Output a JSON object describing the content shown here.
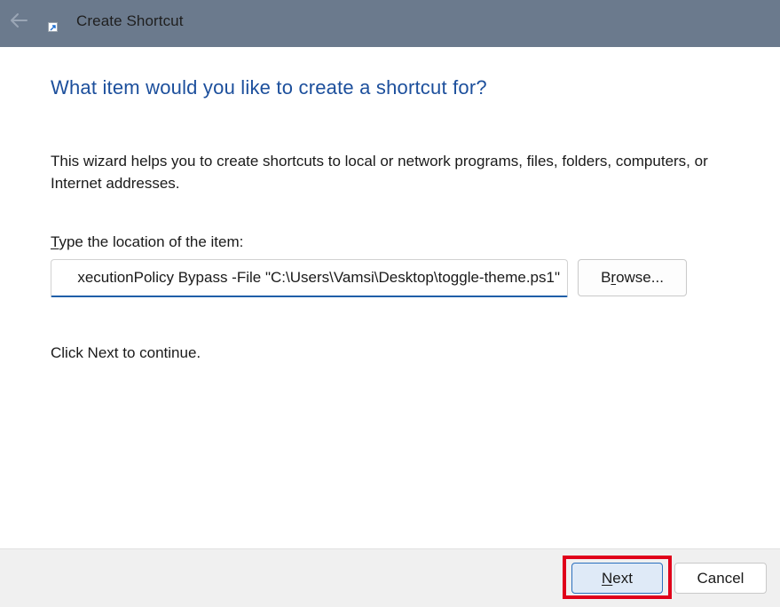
{
  "window": {
    "title": "Create Shortcut",
    "back_icon": "arrow-left-icon",
    "app_icon": "shortcut-icon"
  },
  "main": {
    "heading": "What item would you like to create a shortcut for?",
    "description": "This wizard helps you to create shortcuts to local or network programs, files, folders, computers, or Internet addresses.",
    "location": {
      "label_accel": "T",
      "label_rest": "ype the location of the item:",
      "value": "xecutionPolicy Bypass -File \"C:\\Users\\Vamsi\\Desktop\\toggle-theme.ps1\""
    },
    "browse": {
      "accel_before": "B",
      "accel_letter": "r",
      "accel_after": "owse..."
    },
    "continue_text": "Click Next to continue."
  },
  "footer": {
    "next": {
      "accel": "N",
      "rest": "ext"
    },
    "cancel_label": "Cancel",
    "highlight_color": "#e0001a"
  },
  "colors": {
    "titlebar": "#6b7a8d",
    "heading": "#1c4f9c",
    "input_focus": "#1f5fa8",
    "next_button": "#dfeaf7"
  }
}
